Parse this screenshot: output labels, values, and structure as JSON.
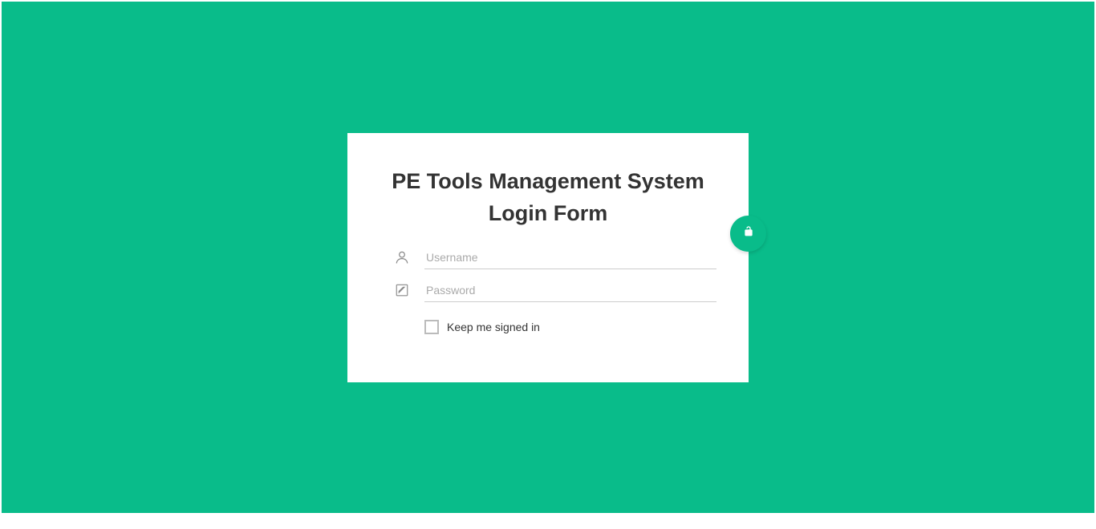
{
  "login": {
    "title_line1": "PE Tools Management System",
    "title_line2": "Login Form",
    "username_placeholder": "Username",
    "password_placeholder": "Password",
    "remember_label": "Keep me signed in"
  },
  "colors": {
    "primary": "#09bc8a"
  }
}
